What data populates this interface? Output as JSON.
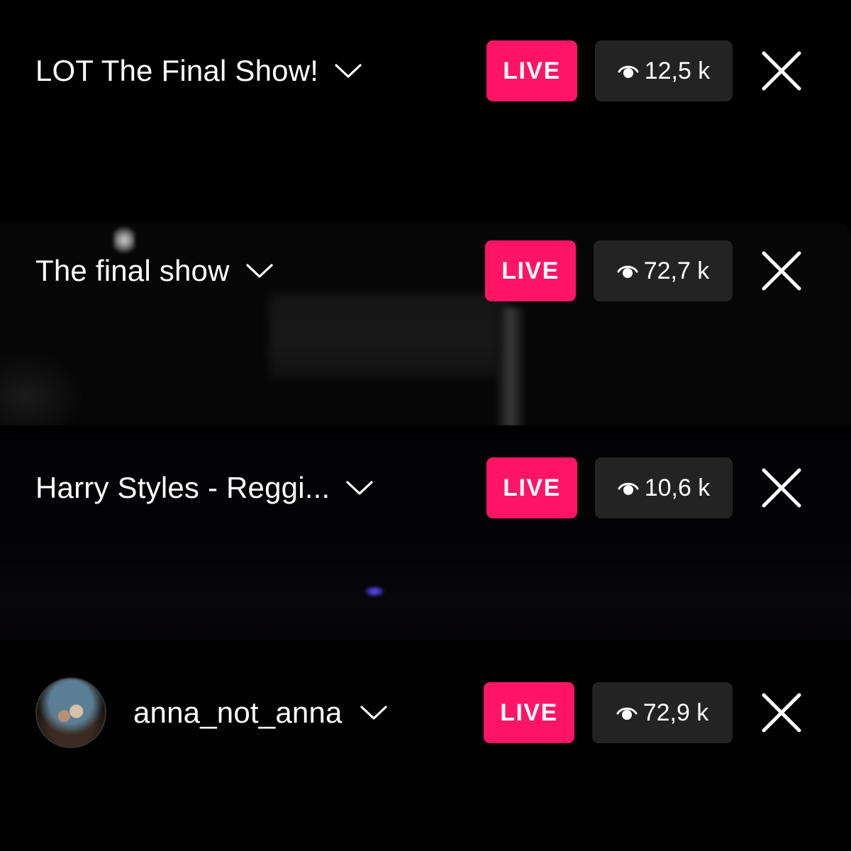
{
  "colors": {
    "live_badge": "#ff1466",
    "viewer_pill": "#232323",
    "background": "#000000",
    "text": "#ffffff"
  },
  "streams": [
    {
      "title": "LOT The Final Show!",
      "live_label": "LIVE",
      "viewers": "12,5 k",
      "icons": [
        "chevron-down-icon",
        "eye-icon",
        "close-icon"
      ]
    },
    {
      "title": "The final show",
      "live_label": "LIVE",
      "viewers": "72,7 k",
      "icons": [
        "chevron-down-icon",
        "eye-icon",
        "close-icon"
      ]
    },
    {
      "title": "Harry Styles - Reggi...",
      "live_label": "LIVE",
      "viewers": "10,6 k",
      "icons": [
        "chevron-down-icon",
        "eye-icon",
        "close-icon"
      ]
    },
    {
      "title": "anna_not_anna",
      "live_label": "LIVE",
      "viewers": "72,9 k",
      "icons": [
        "avatar",
        "chevron-down-icon",
        "eye-icon",
        "close-icon"
      ]
    }
  ]
}
